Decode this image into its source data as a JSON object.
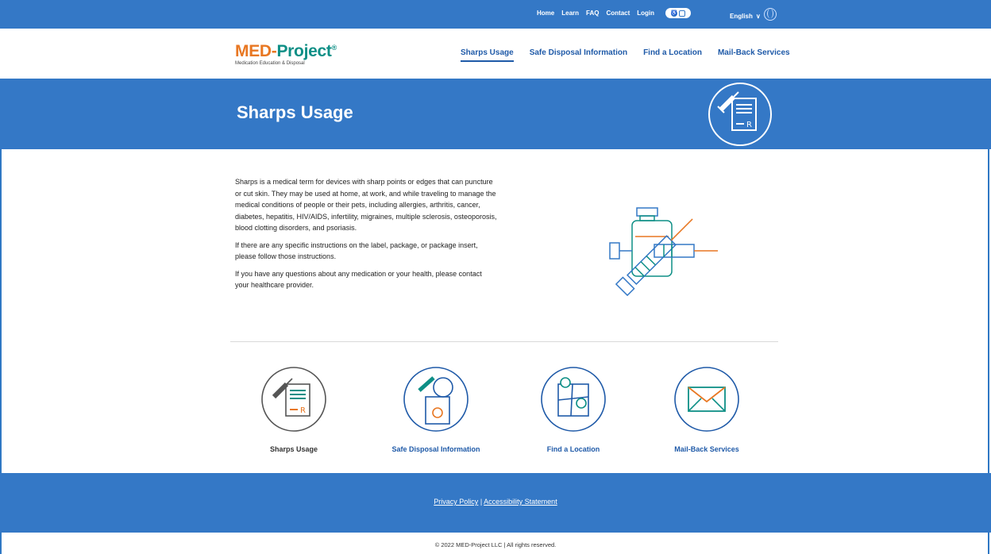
{
  "topbar": {
    "links": [
      "Home",
      "Learn",
      "FAQ",
      "Contact",
      "Login"
    ],
    "accessibility_toggle_icon": "accessibility-icon",
    "language": "English",
    "language_chevron": "∨",
    "globe_icon": "globe-icon"
  },
  "header": {
    "logo_part1": "MED-",
    "logo_part2": "Project",
    "logo_registered": "®",
    "logo_tagline": "Medication Education & Disposal",
    "nav": [
      "Sharps Usage",
      "Safe Disposal Information",
      "Find a Location",
      "Mail-Back Services"
    ],
    "active_nav": "Sharps Usage"
  },
  "hero": {
    "title": "Sharps Usage",
    "icon": "syringe-prescription-icon"
  },
  "content": {
    "paragraphs": [
      "Sharps is a medical term for devices with sharp points or edges that can puncture or cut skin. They may be used at home, at work, and while traveling to manage the medical conditions of people or their pets, including allergies, arthritis, cancer, diabetes, hepatitis, HIV/AIDS, infertility, migraines, multiple sclerosis, osteoporosis, blood clotting disorders, and psoriasis.",
      "If there are any specific instructions on the label, package, or package insert, please follow those instructions.",
      "If you have any questions about any medication or your health, please contact your healthcare provider."
    ],
    "illustration": "vial-and-syringes-icon"
  },
  "cards": [
    {
      "label": "Sharps Usage",
      "icon": "syringe-prescription-icon"
    },
    {
      "label": "Safe Disposal Information",
      "icon": "biohazard-container-icon"
    },
    {
      "label": "Find a Location",
      "icon": "map-pin-icon"
    },
    {
      "label": "Mail-Back Services",
      "icon": "envelope-icon"
    }
  ],
  "footer": {
    "privacy": "Privacy Policy",
    "separator": " | ",
    "accessibility": "Accessibility Statement",
    "copyright": "© 2022 MED-Project LLC | All rights reserved."
  },
  "colors": {
    "brand_blue": "#3478c6",
    "link_blue": "#1f5aa8",
    "orange": "#e87722",
    "teal": "#0e8f86"
  }
}
